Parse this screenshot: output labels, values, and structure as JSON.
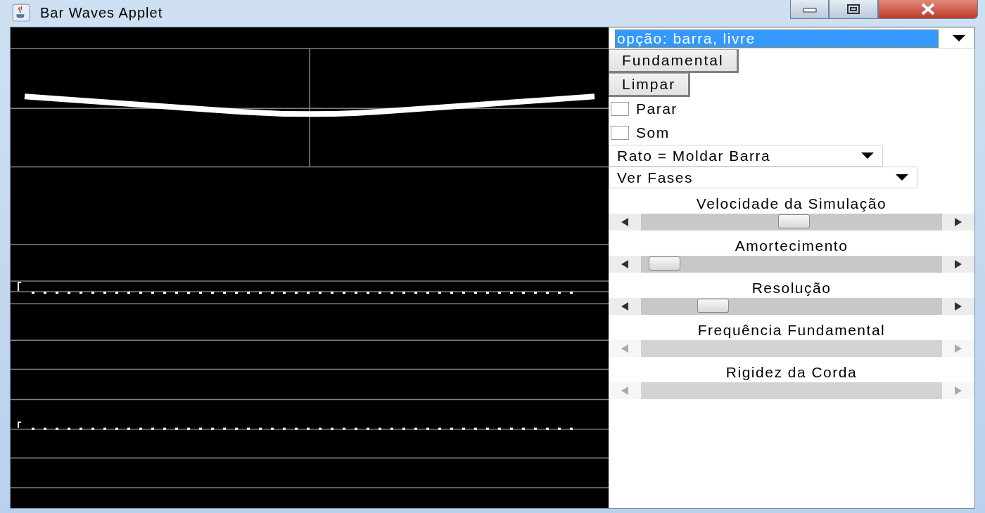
{
  "window": {
    "title": "Bar Waves Applet"
  },
  "controls": [
    {
      "kind": "dropdown",
      "value": "opção: barra, livre",
      "focused": true
    },
    {
      "kind": "button",
      "label": "Fundamental"
    },
    {
      "kind": "button",
      "label": "Limpar"
    },
    {
      "kind": "checkbox",
      "label": "Parar",
      "checked": false
    },
    {
      "kind": "checkbox",
      "label": "Som",
      "checked": false
    },
    {
      "kind": "dropdown",
      "value": "Rato = Moldar Barra",
      "focused": false
    },
    {
      "kind": "dropdown",
      "value": "Ver Fases",
      "focused": false
    },
    {
      "kind": "slider",
      "label": "Velocidade da Simulação",
      "disabled": false,
      "level": 0.51
    },
    {
      "kind": "slider",
      "label": "Amortecimento",
      "disabled": false,
      "level": 0.03
    },
    {
      "kind": "slider",
      "label": "Resolução",
      "disabled": false,
      "level": 0.21
    },
    {
      "kind": "slider",
      "label": "Frequência Fundamental",
      "disabled": true
    },
    {
      "kind": "slider",
      "label": "Rigidez da Corda",
      "disabled": true
    }
  ]
}
